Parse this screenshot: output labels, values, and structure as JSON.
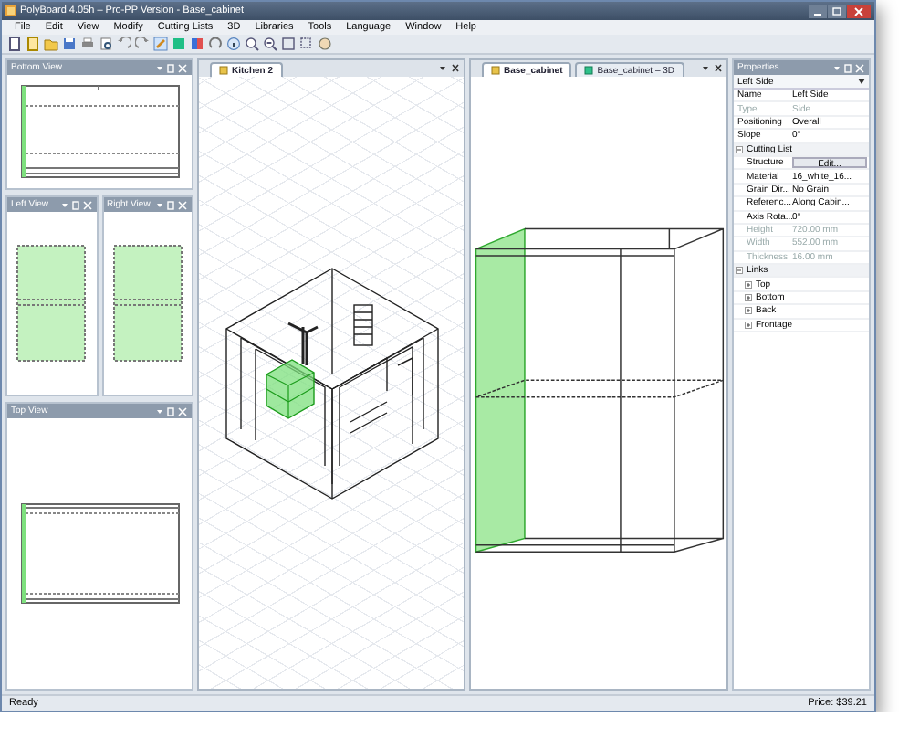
{
  "window": {
    "title": "PolyBoard 4.05h – Pro-PP Version - Base_cabinet"
  },
  "menu": [
    "File",
    "Edit",
    "View",
    "Modify",
    "Cutting Lists",
    "3D",
    "Libraries",
    "Tools",
    "Language",
    "Window",
    "Help"
  ],
  "panels": [
    {
      "title": "Bottom View"
    },
    {
      "title": "Left View"
    },
    {
      "title": "Right View"
    },
    {
      "title": "Top View"
    }
  ],
  "documents": [
    {
      "tabs": [
        {
          "label": "Kitchen 2",
          "selected": true
        }
      ]
    },
    {
      "tabs": [
        {
          "label": "Base_cabinet",
          "selected": true
        },
        {
          "label": "Base_cabinet – 3D",
          "selected": false
        }
      ]
    }
  ],
  "properties": {
    "title": "Properties",
    "object": "Left Side",
    "rows": [
      {
        "kind": "prop",
        "name": "Name",
        "value": "Left Side",
        "disabled": false
      },
      {
        "kind": "prop",
        "name": "Type",
        "value": "Side",
        "disabled": true
      },
      {
        "kind": "prop",
        "name": "Positioning",
        "value": "Overall",
        "disabled": false
      },
      {
        "kind": "prop",
        "name": "Slope",
        "value": "0°",
        "disabled": false
      },
      {
        "kind": "group",
        "name": "Cutting List",
        "expanded": true,
        "children": [
          {
            "kind": "button",
            "name": "Structure",
            "value": "Edit...",
            "disabled": false
          },
          {
            "kind": "prop",
            "name": "Material",
            "value": "16_white_16...",
            "disabled": false
          },
          {
            "kind": "prop",
            "name": "Grain Dir...",
            "value": "No Grain",
            "disabled": false
          },
          {
            "kind": "prop",
            "name": "Referenc...",
            "value": "Along Cabin...",
            "disabled": false
          },
          {
            "kind": "prop",
            "name": "Axis Rota...",
            "value": "0°",
            "disabled": false
          },
          {
            "kind": "prop",
            "name": "Height",
            "value": "720.00 mm",
            "disabled": true
          },
          {
            "kind": "prop",
            "name": "Width",
            "value": "552.00 mm",
            "disabled": true
          },
          {
            "kind": "prop",
            "name": "Thickness",
            "value": "16.00 mm",
            "disabled": true
          }
        ]
      },
      {
        "kind": "group",
        "name": "Links",
        "expanded": true,
        "children": [
          {
            "kind": "group",
            "name": "Top",
            "expanded": false
          },
          {
            "kind": "group",
            "name": "Bottom",
            "expanded": false
          },
          {
            "kind": "group",
            "name": "Back",
            "expanded": false
          },
          {
            "kind": "group",
            "name": "Frontage",
            "expanded": false
          }
        ]
      }
    ]
  },
  "status_bar": {
    "text": "Ready",
    "price": "Price: $39.21"
  }
}
